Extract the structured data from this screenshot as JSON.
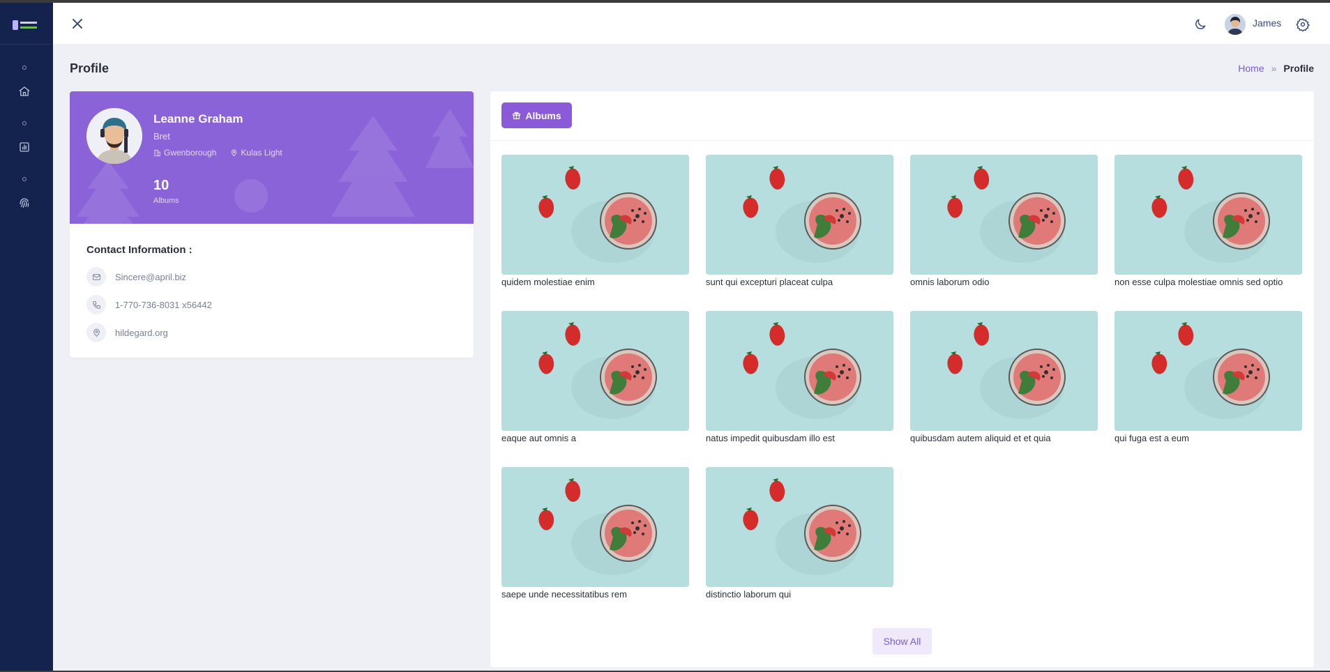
{
  "sidebar": {
    "logo_icon": "app-logo",
    "items": [
      {
        "icon": "home-icon"
      },
      {
        "icon": "chart-icon"
      },
      {
        "icon": "fingerprint-icon"
      }
    ]
  },
  "header": {
    "close_icon": "close-icon",
    "theme_icon": "moon-icon",
    "user_name": "James",
    "settings_icon": "gear-icon"
  },
  "page": {
    "title": "Profile",
    "breadcrumb": {
      "home": "Home",
      "separator": "»",
      "current": "Profile"
    }
  },
  "profile": {
    "name": "Leanne Graham",
    "username": "Bret",
    "city": "Gwenborough",
    "street": "Kulas Light",
    "album_count": "10",
    "album_count_label": "Albums",
    "banner_color": "#8a63d8"
  },
  "contact": {
    "title": "Contact Information :",
    "email": "Sincere@april.biz",
    "phone": "1-770-736-8031 x56442",
    "website": "hildegard.org"
  },
  "albums": {
    "tab_label": "Albums",
    "accent_color": "#8a5ad8",
    "items": [
      {
        "title": "quidem molestiae enim"
      },
      {
        "title": "sunt qui excepturi placeat culpa"
      },
      {
        "title": "omnis laborum odio"
      },
      {
        "title": "non esse culpa molestiae omnis sed optio"
      },
      {
        "title": "eaque aut omnis a"
      },
      {
        "title": "natus impedit quibusdam illo est"
      },
      {
        "title": "quibusdam autem aliquid et et quia"
      },
      {
        "title": "qui fuga est a eum"
      },
      {
        "title": "saepe unde necessitatibus rem"
      },
      {
        "title": "distinctio laborum qui"
      }
    ],
    "show_all_label": "Show All"
  }
}
